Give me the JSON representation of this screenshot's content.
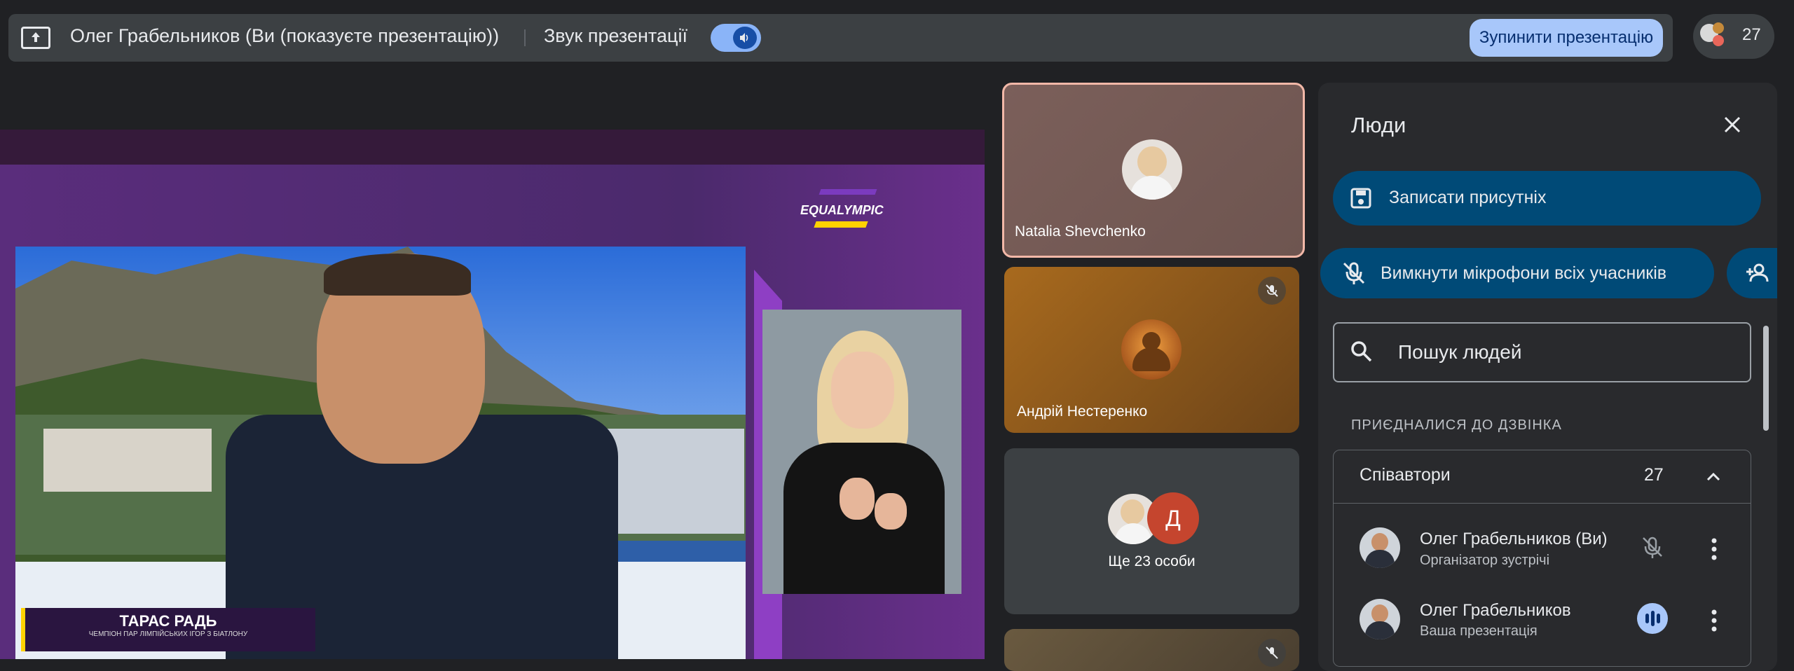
{
  "topbar": {
    "presenter_text": "Олег Грабельников (Ви (показуєте презентацію))",
    "sound_label": "Звук презентації",
    "stop_button": "Зупинити презентацію",
    "participant_count": "27"
  },
  "stage": {
    "logo_text": "EQUALYMPIC",
    "lower_third_name": "ТАРАС РАДЬ",
    "lower_third_subtitle": "ЧЕМПІОН ПАР  ЛІМПІЙСЬКИХ ІГОР З БІАТЛОНУ"
  },
  "tiles": [
    {
      "name": "Natalia Shevchenko"
    },
    {
      "name": "Андрій Нестеренко"
    },
    {
      "name": "Ще 23 особи",
      "initial": "Д"
    },
    {
      "name": ""
    }
  ],
  "panel": {
    "title": "Люди",
    "record_button": "Записати присутніх",
    "mute_all_button": "Вимкнути мікрофони всіх учасників",
    "search_placeholder": "Пошук людей",
    "section_label": "ПРИЄДНАЛИСЯ ДО ДЗВІНКА",
    "cohosts_title": "Співавтори",
    "cohosts_count": "27",
    "people": [
      {
        "name": "Олег Грабельников (Ви)",
        "role": "Організатор зустрічі"
      },
      {
        "name": "Олег Грабельников",
        "role": "Ваша презентація"
      }
    ]
  },
  "colors": {
    "accent": "#a8c7fa",
    "panel_button": "#004a77",
    "stage_purple": "#4a2d6b",
    "highlight_border": "#f2b8a8"
  },
  "icons": [
    "present-icon",
    "volume-icon",
    "close-icon",
    "save-icon",
    "mic-off-icon",
    "add-person-icon",
    "search-icon",
    "chevron-up-icon",
    "more-vert-icon"
  ]
}
